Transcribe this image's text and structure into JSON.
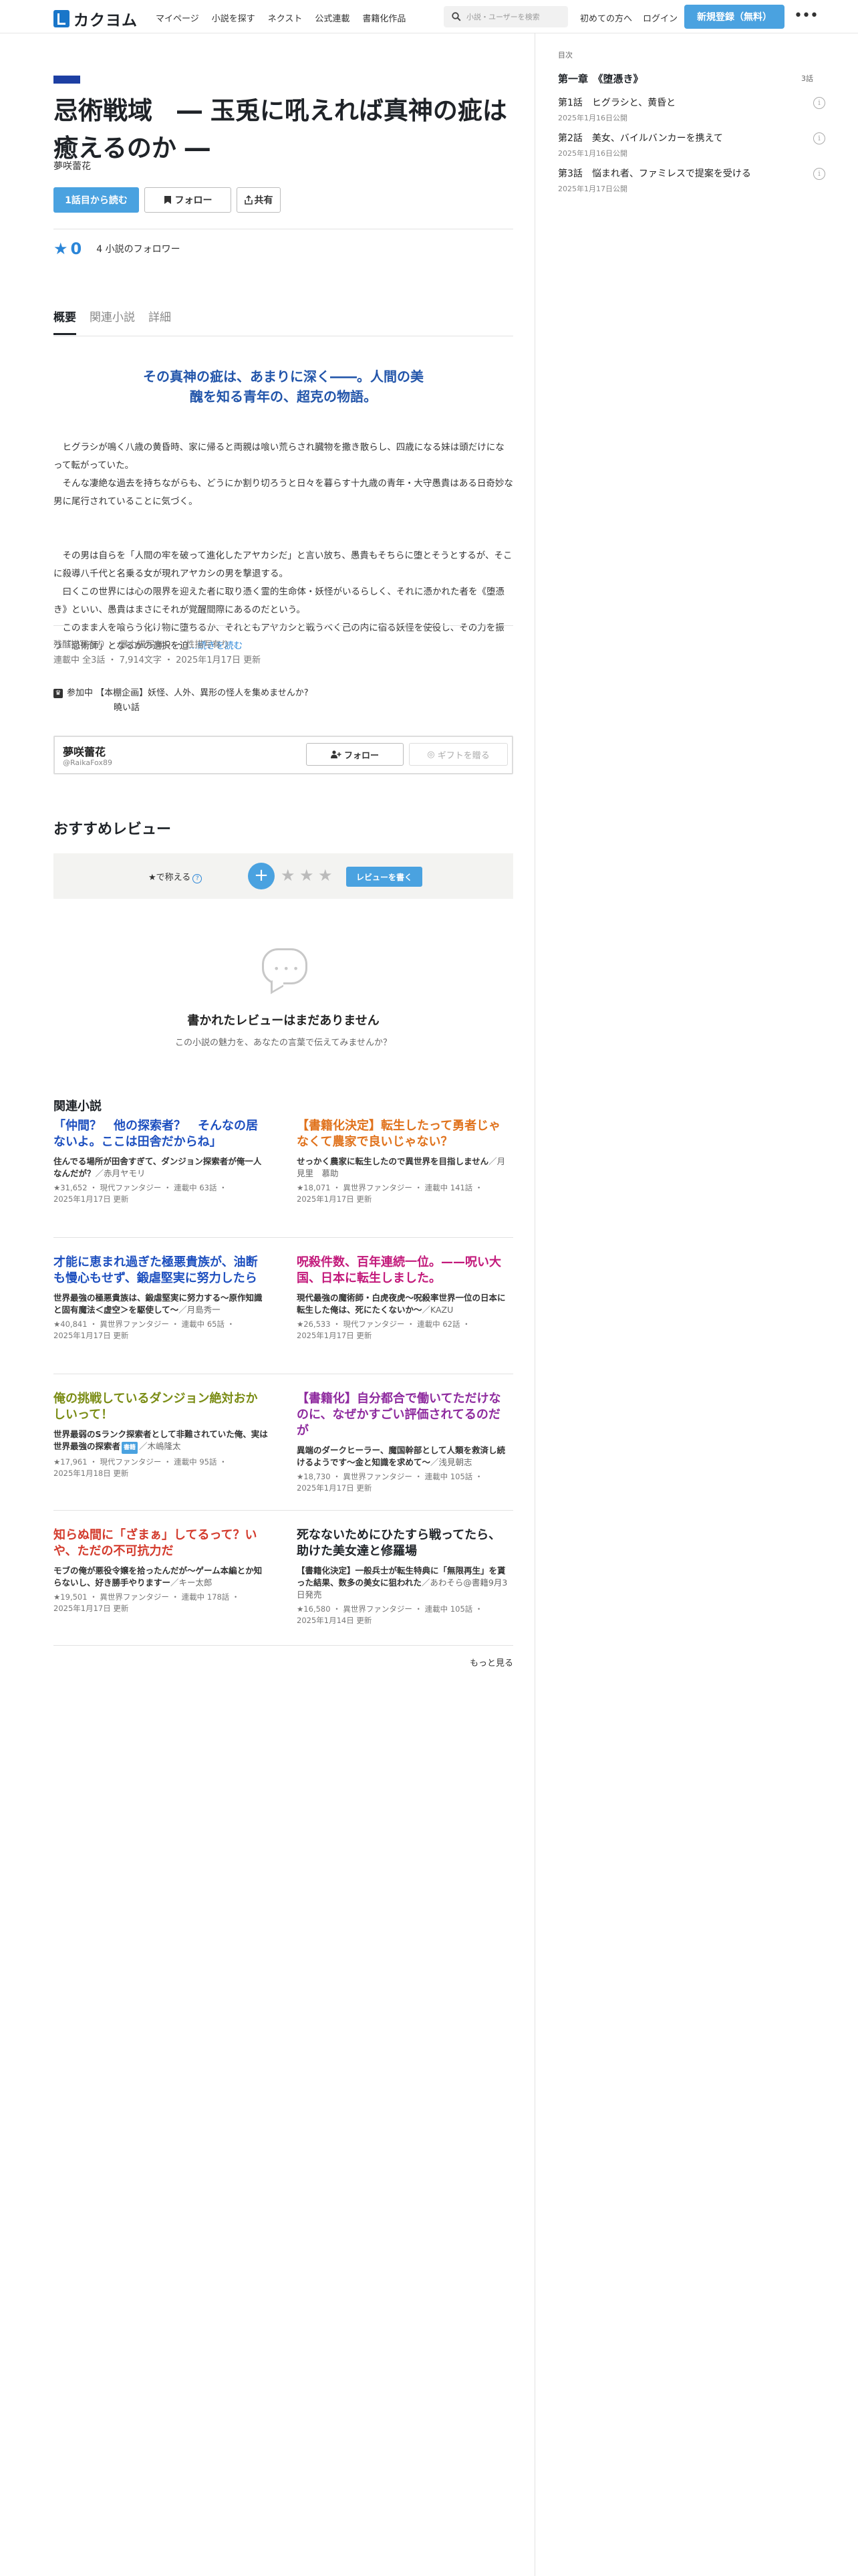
{
  "header": {
    "logo_text": "カクヨム",
    "nav": [
      "マイページ",
      "小説を探す",
      "ネクスト",
      "公式連載",
      "書籍化作品"
    ],
    "search_placeholder": "小説・ユーザーを検索",
    "first_time": "初めての方へ",
    "login": "ログイン",
    "register": "新規登録（無料）",
    "more": "•••"
  },
  "work": {
    "title": "忌術戦域　― 玉兎に吼えれば真神の疵は癒えるのか ―",
    "author": "夢咲蕾花",
    "read_first": "1話目から読む",
    "follow": "フォロー",
    "share": "共有",
    "stars": "0",
    "followers": "4 小説のフォロワー"
  },
  "tabs": [
    "概要",
    "関連小説",
    "詳細"
  ],
  "summary": {
    "catchphrase_lines": [
      "その真神の疵は、あまりに深く――。人間の美",
      "醜を知る青年の、超克の物語。"
    ],
    "paragraphs": [
      "　ヒグラシが鳴く八歳の黄昏時、家に帰ると両親は喰い荒らされ臓物を撒き散らし、四歳になる妹は頭だけになって転がっていた。",
      "　そんな凄絶な過去を持ちながらも、どうにか割り切ろうと日々を暮らす十九歳の青年・大守愚貴はある日奇妙な男に尾行されていることに気づく。",
      "",
      "　その男は自らを「人間の牢を破って進化したアヤカシだ」と言い放ち、愚貴もそちらに堕とそうとするが、そこに殺導八千代と名乗る女が現れアヤカシの男を撃退する。",
      "　曰くこの世界には心の限界を迎えた者に取り憑く霊的生命体・妖怪がいるらしく、それに憑かれた者を《堕憑き》といい、愚貴はまさにそれが覚醒間際にあるのだという。",
      "　このまま人を喰らう化け物に堕ちるか、それともアヤカシと戦うべく己の内に宿る妖怪を使役し、その力を振う「忌術師」となるかの選択を迫"
    ],
    "read_more": "…続きを読む"
  },
  "meta": {
    "tags": "残酷描写有り ・ 暴力描写有り ・ 性描写有り",
    "status": "連載中 全3話 ・ 7,914文字 ・ 2025年1月17日 更新",
    "contest_line1": "参加中 【本棚企画】妖怪、人外、異形の怪人を集めませんか?",
    "contest_line2": "曉い話"
  },
  "author_box": {
    "name": "夢咲蕾花",
    "handle": "@RaikaFox89",
    "follow": "フォロー",
    "gift": "ギフトを贈る"
  },
  "reviews": {
    "heading": "おすすめレビュー",
    "teach": "★で称える",
    "help": "?",
    "plus": "+",
    "write": "レビューを書く",
    "empty_title": "書かれたレビューはまだありません",
    "empty_sub": "この小説の魅力を、あなたの言葉で伝えてみませんか？"
  },
  "related": {
    "heading": "関連小説",
    "items": [
      {
        "title": "「仲間？　他の探索者？　そんなの居ないよ。ここは田舎だからね」",
        "color": "#1d4fbf",
        "catch": "住んでる場所が田舎すぎて、ダンジョン探索者が俺一人なんだが？",
        "author": "／赤月ヤモリ",
        "new": "",
        "meta1": "★31,652 ・ 現代ファンタジー ・ 連載中 63話 ・",
        "meta2": "2025年1月17日 更新"
      },
      {
        "title": "【書籍化決定】転生したって勇者じゃなくて農家で良いじゃない？",
        "color": "#e0721c",
        "catch": "せっかく農家に転生したので異世界を目指しません",
        "author": "／月見里　慕助",
        "new": "",
        "meta1": "★18,071 ・ 異世界ファンタジー ・ 連載中 141話 ・",
        "meta2": "2025年1月17日 更新"
      },
      {
        "title": "才能に恵まれ過ぎた極悪貴族が、油断も慢心もせず、鍛虐堅実に努力したら",
        "color": "#1d4fbf",
        "catch": "世界最強の極悪貴族は、鍛虐堅実に努力する〜原作知識と固有魔法＜虚空＞を駆使して〜",
        "author": "／月島秀一",
        "new": "",
        "meta1": "★40,841 ・ 異世界ファンタジー ・ 連載中 65話 ・",
        "meta2": "2025年1月17日 更新"
      },
      {
        "title": "呪殺件数、百年連続一位。——呪い大国、日本に転生しました。",
        "color": "#c2187a",
        "catch": "現代最強の魔術師・白虎夜虎〜呪殺率世界一位の日本に転生した俺は、死にたくないか〜",
        "author": "／KAZU",
        "new": "",
        "meta1": "★26,533 ・ 現代ファンタジー ・ 連載中 62話 ・",
        "meta2": "2025年1月17日 更新"
      },
      {
        "title": "俺の挑戦しているダンジョン絶対おかしいって！",
        "color": "#7a8c14",
        "catch": "世界最弱のSランク探索者として非難されていた俺、実は世界最強の探索者",
        "author": "／木嶋隆太",
        "new": "書籍",
        "meta1": "★17,961 ・ 現代ファンタジー ・ 連載中 95話 ・",
        "meta2": "2025年1月18日 更新"
      },
      {
        "title": "【書籍化】自分都合で働いてただけなのに、なぜかすごい評価されてるのだが",
        "color": "#8e2a9e",
        "catch": "異端のダークヒーラー、魔国幹部として人類を救済し続けるようです〜金と知識を求めて〜",
        "author": "／浅見朝志",
        "new": "",
        "meta1": "★18,730 ・ 異世界ファンタジー ・ 連載中 105話 ・",
        "meta2": "2025年1月17日 更新"
      },
      {
        "title": "知らぬ間に「ざまぁ」してるって？いや、ただの不可抗力だ",
        "color": "#d33a2c",
        "catch": "モブの俺が悪役令嬢を拾ったんだが〜ゲーム本編とか知らないし、好き勝手やりますー",
        "author": "／キー太郎",
        "new": "",
        "meta1": "★19,501 ・ 異世界ファンタジー ・ 連載中 178話 ・",
        "meta2": "2025年1月17日 更新"
      },
      {
        "title": "死なないためにひたすら戦ってたら、助けた美女達と修羅場",
        "color": "#1f2328",
        "catch": "【書籍化決定】一般兵士が転生特典に「無限再生」を貰った結果、数多の美女に狙われた",
        "author": "／あわそら@書籍9月3日発売",
        "new": "",
        "meta1": "★16,580 ・ 異世界ファンタジー ・ 連載中 105話 ・",
        "meta2": "2025年1月14日 更新"
      }
    ],
    "more": "もっと見る"
  },
  "toc": {
    "caption": "目次",
    "chapter": "第一章　《堕憑き》",
    "count": "3話",
    "episodes": [
      {
        "title": "第1話　ヒグラシと、黄昏と",
        "date": "2025年1月16日公開"
      },
      {
        "title": "第2話　美女、バイルバンカーを携えて",
        "date": "2025年1月16日公開"
      },
      {
        "title": "第3話　悩まれ者、ファミレスで提案を受ける",
        "date": "2025年1月17日公開"
      }
    ]
  },
  "colors": {
    "accent": "#4aa2e0",
    "brand": "#1976c9",
    "catch": "#2255aa",
    "deco": "#1d3fa3"
  },
  "icons": [
    "search-icon",
    "bookmark-icon",
    "share-icon",
    "star-icon",
    "trophy-icon",
    "user-plus-icon",
    "gift-icon",
    "info-icon",
    "speech-bubble-icon"
  ]
}
